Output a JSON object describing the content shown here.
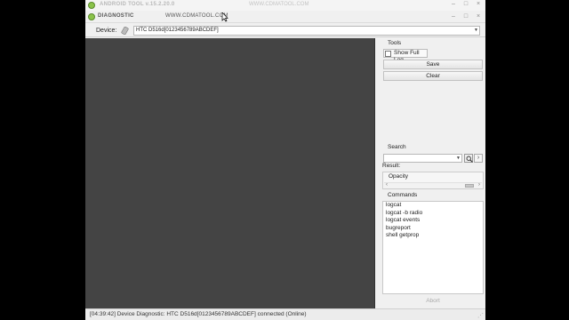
{
  "titlebar": {
    "title": "ANDROID TOOL v.15.2.20.0",
    "url": "WWW.CDMATOOL.COM",
    "buttons": [
      "–",
      "□",
      "×"
    ]
  },
  "tabbar": {
    "label": "DIAGNOSTIC",
    "url": "WWW.CDMATOOL.COM",
    "buttons": [
      "–",
      "□",
      "×"
    ]
  },
  "device": {
    "label": "Device:",
    "value": "HTC D516d[0123456789ABCDEF]",
    "dropdown_arrow": "▼"
  },
  "sidebar": {
    "tools_title": "Tools",
    "show_full_log": "Show Full Log",
    "save": "Save",
    "clear": "Clear",
    "search_title": "Search",
    "search_next": "›",
    "result_label": "Result:",
    "opacity_label": "Opacity",
    "scroll_left": "‹",
    "scroll_right": "›",
    "commands_title": "Commands",
    "commands": [
      "logcat",
      "logcat -b radio",
      "logcat events",
      "bugreport",
      "shell getprop"
    ],
    "abort": "Abort"
  },
  "status": {
    "text": "[04:39:42] Device Diagnostic: HTC D516d[0123456789ABCDEF] connected (Online)"
  },
  "icons": {
    "app": "android-icon",
    "device": "phone-icon",
    "search": "magnifier-icon"
  }
}
